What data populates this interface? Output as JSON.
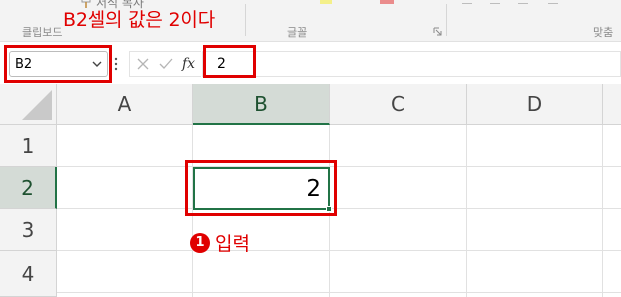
{
  "ribbon": {
    "format_painter_label": "서식 복사",
    "group_clipboard": "클립보드",
    "group_font": "글꼴",
    "group_alignment": "맞춤",
    "icons": [
      "format-painter-icon",
      "dialog-launcher-icon"
    ],
    "swatch_colors": {
      "highlight": "#f4f08a",
      "font": "#ea8c8c"
    }
  },
  "annotations": {
    "title": "B2셀의 값은 2이다",
    "step_number": "1",
    "step_label": "입력",
    "color": "#e00000"
  },
  "formula_bar": {
    "name_box": "B2",
    "fx_label": "fx",
    "formula": "2",
    "icons": [
      "chevron-down-icon",
      "more-options-icon",
      "cancel-icon",
      "enter-check-icon",
      "insert-function-icon"
    ]
  },
  "sheet": {
    "columns": [
      "A",
      "B",
      "C",
      "D"
    ],
    "rows": [
      "1",
      "2",
      "3",
      "4"
    ],
    "selected_column": "B",
    "selected_row": "2",
    "active_cell": {
      "ref": "B2",
      "value": "2"
    },
    "accent_color": "#217346"
  }
}
